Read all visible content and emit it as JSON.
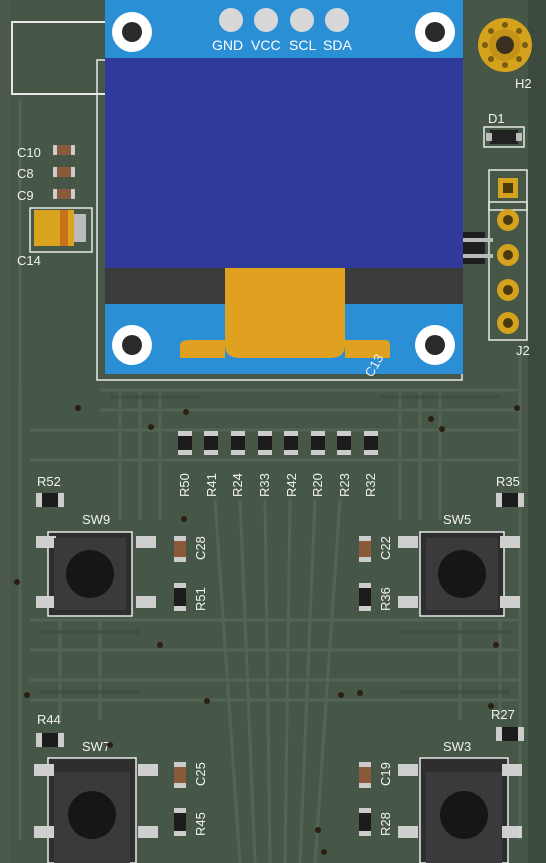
{
  "board": {
    "colors": {
      "pcb": "#4a5a4a",
      "trace": "#55665a",
      "silk": "#f0f0f0",
      "oled_blue": "#2f3a9a",
      "oled_frame": "#2b8fd6",
      "flex": "#e0a020",
      "gold": "#d4a21c"
    }
  },
  "oled": {
    "pins": [
      "GND",
      "VCC",
      "SCL",
      "SDA"
    ],
    "ref": "C13"
  },
  "labels": {
    "h2": "H2",
    "d1": "D1",
    "j2": "J2",
    "c10": "C10",
    "c8": "C8",
    "c9": "C9",
    "c14": "C14",
    "resistor_row": [
      "R50",
      "R41",
      "R24",
      "R33",
      "R42",
      "R20",
      "R23",
      "R32"
    ],
    "r52": "R52",
    "r35": "R35",
    "sw9": "SW9",
    "sw5": "SW5",
    "c28": "C28",
    "r51": "R51",
    "c22": "C22",
    "r36": "R36",
    "r44": "R44",
    "r27": "R27",
    "sw7": "SW7",
    "sw3": "SW3",
    "c25": "C25",
    "r45": "R45",
    "c19": "C19",
    "r28": "R28"
  }
}
